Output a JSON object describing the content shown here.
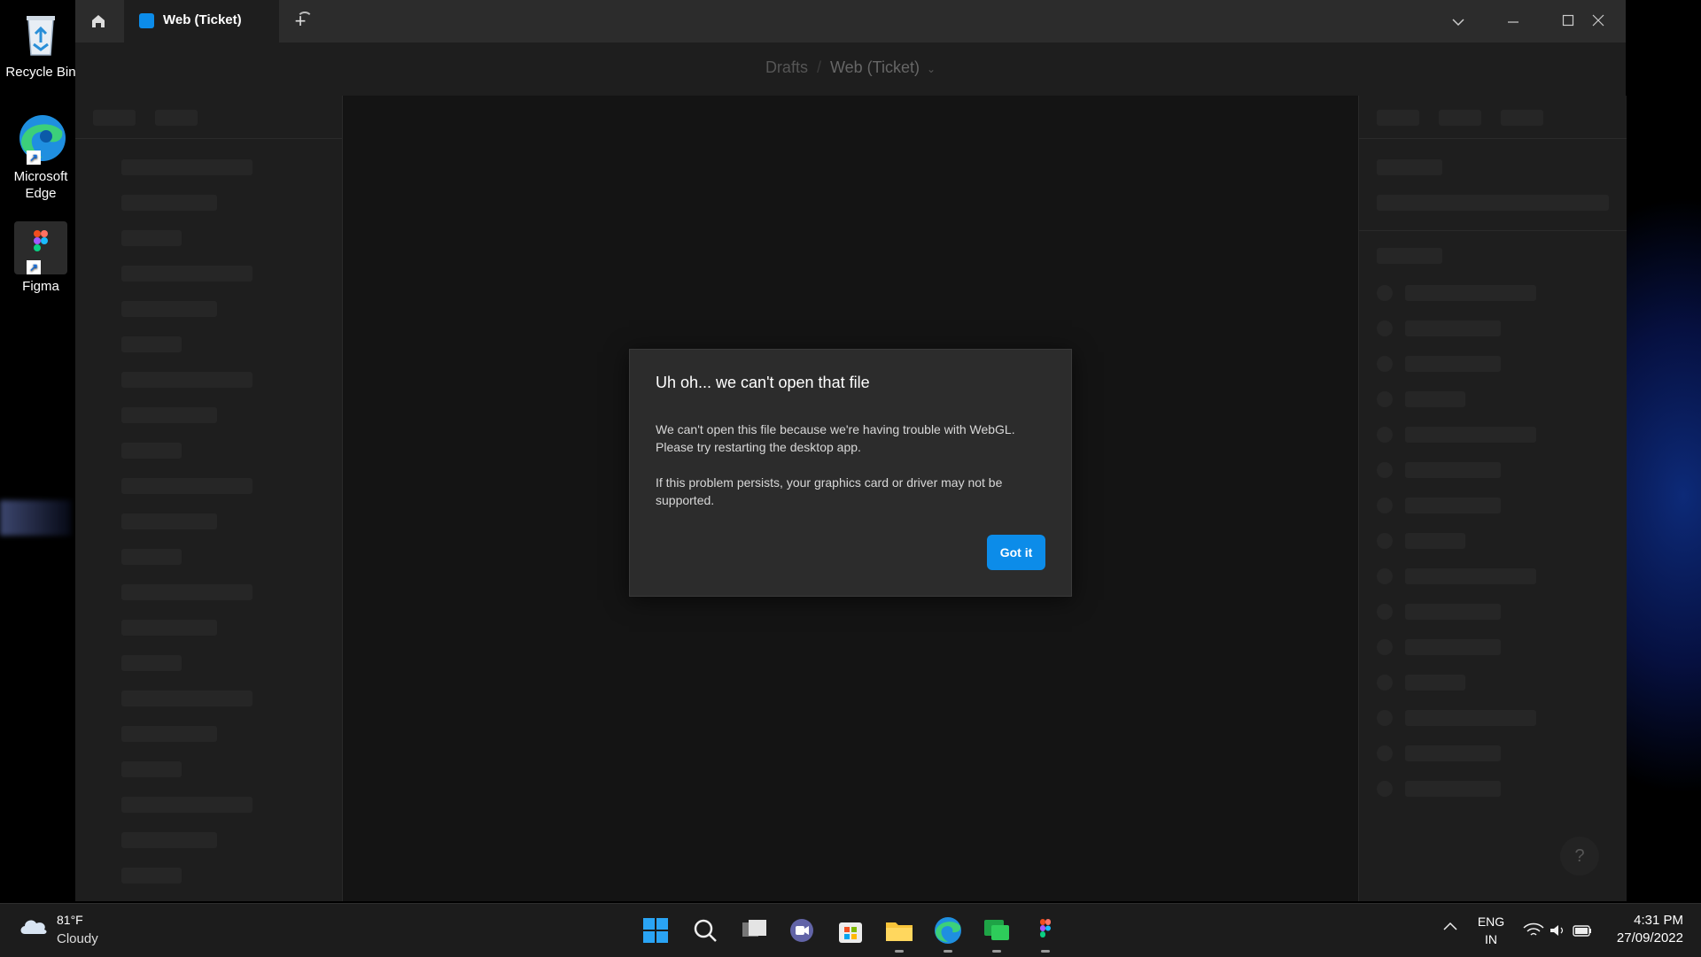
{
  "desktop": {
    "icons": [
      {
        "label": "Recycle Bin"
      },
      {
        "label": "Microsoft Edge"
      },
      {
        "label": "Figma"
      }
    ]
  },
  "window": {
    "tab": {
      "label": "Web (Ticket)"
    },
    "new_tab": "+",
    "breadcrumb": {
      "parent": "Drafts",
      "separator": "/",
      "file": "Web (Ticket)"
    }
  },
  "dialog": {
    "title": "Uh oh... we can't open that file",
    "paragraph1": "We can't open this file because we're having trouble with WebGL. Please try restarting the desktop app.",
    "paragraph2": "If this problem persists, your graphics card or driver may not be supported.",
    "button": "Got it"
  },
  "help": "?",
  "taskbar": {
    "weather": {
      "temp": "81°F",
      "condition": "Cloudy"
    },
    "apps": [
      "start-icon",
      "search-icon",
      "task-view-icon",
      "teams-chat-icon",
      "microsoft-store-icon",
      "file-explorer-icon",
      "edge-icon",
      "chat-app-icon",
      "figma-icon"
    ],
    "language": {
      "line1": "ENG",
      "line2": "IN"
    },
    "time": "4:31 PM",
    "date": "27/09/2022"
  },
  "colors": {
    "accent": "#0c8ce9",
    "window_bg": "#1e1e1e",
    "canvas_bg": "#141414"
  }
}
